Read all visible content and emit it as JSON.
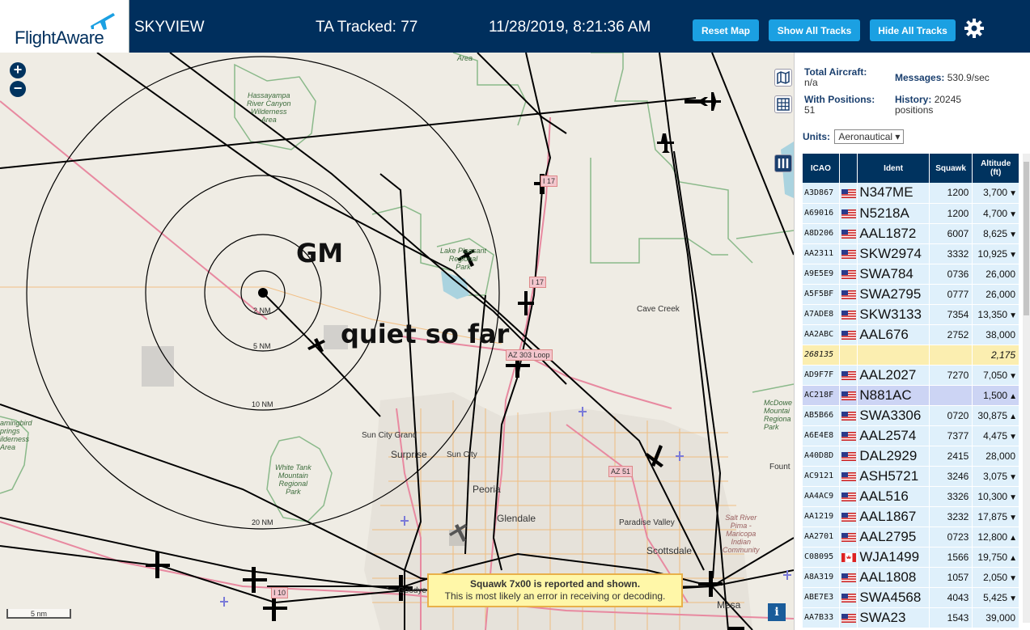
{
  "header": {
    "logo_text": "FlightAware",
    "app_title": "SKYVIEW",
    "ta_tracked": "TA Tracked: 77",
    "datetime": "11/28/2019, 8:21:36 AM",
    "buttons": {
      "reset": "Reset Map",
      "show_all": "Show All Tracks",
      "hide_all": "Hide All Tracks"
    },
    "settings_icon": "gear-icon"
  },
  "map": {
    "annotations": {
      "gm": "GM",
      "quiet": "quiet so far"
    },
    "zoom_in": "+",
    "zoom_out": "−",
    "ring_labels": [
      "2 NM",
      "5 NM",
      "10 NM",
      "20 NM"
    ],
    "places": {
      "area": "Area",
      "hassayampa": "Hassayampa\nRiver Canyon\nWilderness\nArea",
      "lake_pleasant": "Lake Pleasant\nRegional\nPark",
      "white_tank": "White Tank\nMountain\nRegional\nPark",
      "hummingbird": "amingbird\nprings\nilderness\nArea",
      "mcdowell": "McDowe\nMountai\nRegiona\nPark",
      "salt_river": "Salt River\nPima -\nMaricopa\nIndian\nCommunity"
    },
    "cities": {
      "cave_creek": "Cave Creek",
      "sun_city_grand": "Sun City Grand",
      "surprise": "Surprise",
      "sun_city": "Sun City",
      "peoria": "Peoria",
      "glendale": "Glendale",
      "paradise_valley": "Paradise Valley",
      "scottsdale": "Scottsdale",
      "mesa": "Mesa",
      "fountain": "Fount",
      "goodyear": "Goodye"
    },
    "highways": {
      "i17a": "I 17",
      "i17b": "I 17",
      "loop303": "AZ 303 Loop",
      "az51": "AZ 51",
      "i10": "I 10"
    },
    "squawk_alert": {
      "title": "Squawk 7x00 is reported and shown.",
      "message": "This is most likely an error in receiving or decoding."
    },
    "scale_bar": "5 nm",
    "info_icon": "i"
  },
  "panel": {
    "total_aircraft_label": "Total Aircraft:",
    "total_aircraft_value": "n/a",
    "with_positions_label": "With Positions:",
    "with_positions_value": "51",
    "messages_label": "Messages:",
    "messages_value": "530.9/sec",
    "history_label": "History:",
    "history_value": "20245",
    "history_unit": "positions",
    "units_label": "Units:",
    "units_value": "Aeronautical",
    "columns": [
      "ICAO",
      "",
      "Ident",
      "Squawk",
      "Altitude\n(ft)"
    ],
    "rows": [
      {
        "icao": "A3D867",
        "flag": "us",
        "ident": "N347ME",
        "squawk": "1200",
        "alt": "3,700",
        "trend": "▼"
      },
      {
        "icao": "A69016",
        "flag": "us",
        "ident": "N5218A",
        "squawk": "1200",
        "alt": "4,700",
        "trend": "▼"
      },
      {
        "icao": "A8D206",
        "flag": "us",
        "ident": "AAL1872",
        "squawk": "6007",
        "alt": "8,625",
        "trend": "▼"
      },
      {
        "icao": "AA2311",
        "flag": "us",
        "ident": "SKW2974",
        "squawk": "3332",
        "alt": "10,925",
        "trend": "▼"
      },
      {
        "icao": "A9E5E9",
        "flag": "us",
        "ident": "SWA784",
        "squawk": "0736",
        "alt": "26,000",
        "trend": ""
      },
      {
        "icao": "A5F5BF",
        "flag": "us",
        "ident": "SWA2795",
        "squawk": "0777",
        "alt": "26,000",
        "trend": ""
      },
      {
        "icao": "A7ADE8",
        "flag": "us",
        "ident": "SKW3133",
        "squawk": "7354",
        "alt": "13,350",
        "trend": "▼"
      },
      {
        "icao": "AA2ABC",
        "flag": "us",
        "ident": "AAL676",
        "squawk": "2752",
        "alt": "38,000",
        "trend": ""
      },
      {
        "icao": "268135",
        "flag": "",
        "ident": "",
        "squawk": "",
        "alt": "2,175",
        "trend": "",
        "style": "highlight"
      },
      {
        "icao": "AD9F7F",
        "flag": "us",
        "ident": "AAL2027",
        "squawk": "7270",
        "alt": "7,050",
        "trend": "▼"
      },
      {
        "icao": "AC218F",
        "flag": "us",
        "ident": "N881AC",
        "squawk": "",
        "alt": "1,500",
        "trend": "▲",
        "style": "selected"
      },
      {
        "icao": "AB5B66",
        "flag": "us",
        "ident": "SWA3306",
        "squawk": "0720",
        "alt": "30,875",
        "trend": "▲"
      },
      {
        "icao": "A6E4E8",
        "flag": "us",
        "ident": "AAL2574",
        "squawk": "7377",
        "alt": "4,475",
        "trend": "▼"
      },
      {
        "icao": "A40D8D",
        "flag": "us",
        "ident": "DAL2929",
        "squawk": "2415",
        "alt": "28,000",
        "trend": ""
      },
      {
        "icao": "AC9121",
        "flag": "us",
        "ident": "ASH5721",
        "squawk": "3246",
        "alt": "3,075",
        "trend": "▼"
      },
      {
        "icao": "AA4AC9",
        "flag": "us",
        "ident": "AAL516",
        "squawk": "3326",
        "alt": "10,300",
        "trend": "▼"
      },
      {
        "icao": "AA1219",
        "flag": "us",
        "ident": "AAL1867",
        "squawk": "3232",
        "alt": "17,875",
        "trend": "▼"
      },
      {
        "icao": "AA2701",
        "flag": "us",
        "ident": "AAL2795",
        "squawk": "0723",
        "alt": "12,800",
        "trend": "▲"
      },
      {
        "icao": "C08095",
        "flag": "ca",
        "ident": "WJA1499",
        "squawk": "1566",
        "alt": "19,750",
        "trend": "▲"
      },
      {
        "icao": "A8A319",
        "flag": "us",
        "ident": "AAL1808",
        "squawk": "1057",
        "alt": "2,050",
        "trend": "▼"
      },
      {
        "icao": "ABE7E3",
        "flag": "us",
        "ident": "SWA4568",
        "squawk": "4043",
        "alt": "5,425",
        "trend": "▼"
      },
      {
        "icao": "AA7B33",
        "flag": "us",
        "ident": "SWA23",
        "squawk": "1543",
        "alt": "39,000",
        "trend": ""
      }
    ]
  }
}
